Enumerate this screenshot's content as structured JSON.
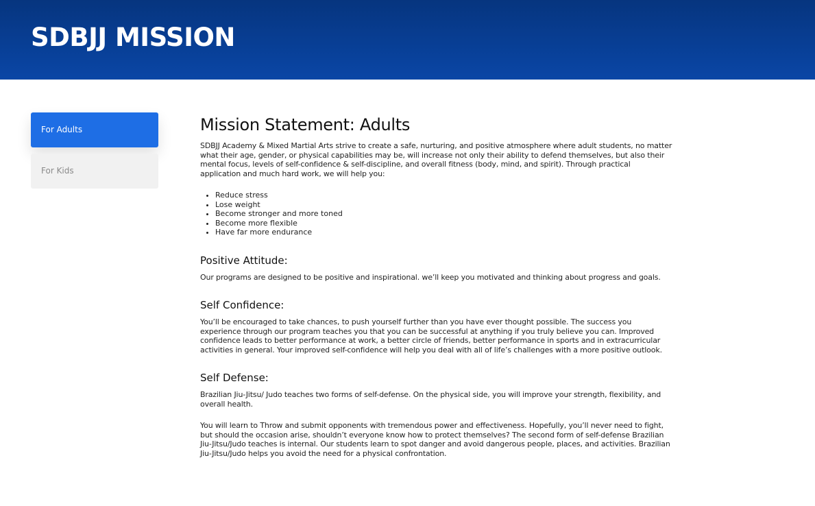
{
  "header": {
    "title": "SDBJJ MISSION"
  },
  "sidebar": {
    "items": [
      {
        "label": "For Adults",
        "active": true
      },
      {
        "label": "For Kids",
        "active": false
      }
    ]
  },
  "main": {
    "heading": "Mission Statement: Adults",
    "intro": "SDBJJ Academy & Mixed Martial Arts strive to create a safe, nurturing, and positive atmosphere where adult students, no matter what their age, gender, or physical capabilities may be, will increase not only their ability to defend themselves, but also their mental focus, levels of self-confidence & self-discipline, and overall fitness (body, mind, and spirit). Through practical application and much hard work, we will help you:",
    "benefits": [
      "Reduce stress",
      "Lose weight",
      "Become stronger and more toned",
      "Become more flexible",
      "Have far more endurance"
    ],
    "sections": [
      {
        "title": "Positive Attitude:",
        "paragraphs": [
          "Our programs are designed to be positive and inspirational. we’ll keep you motivated and thinking about progress and goals."
        ]
      },
      {
        "title": "Self Confidence:",
        "paragraphs": [
          "You’ll be encouraged to take chances, to push yourself further than you have ever thought possible. The success you experience through our program teaches you that you can be successful at anything if you truly believe you can. Improved confidence leads to better performance at work, a better circle of friends, better performance in sports and in extracurricular activities in general. Your improved self-confidence will help you deal with all of life’s challenges with a more positive outlook."
        ]
      },
      {
        "title": "Self Defense:",
        "paragraphs": [
          "Brazilian Jiu-Jitsu/ Judo teaches two forms of self-defense. On the physical side, you will improve your strength, flexibility, and overall health.",
          "You will learn to Throw and submit opponents with tremendous power and effectiveness. Hopefully, you’ll never need to fight, but should the occasion arise, shouldn’t everyone know how to protect themselves? The second form of self-defense Brazilian Jiu-Jitsu/Judo teaches is internal. Our students learn to spot danger and avoid dangerous people, places, and activities. Brazilian Jiu-Jitsu/Judo helps you avoid the need for a physical confrontation."
        ]
      }
    ]
  }
}
